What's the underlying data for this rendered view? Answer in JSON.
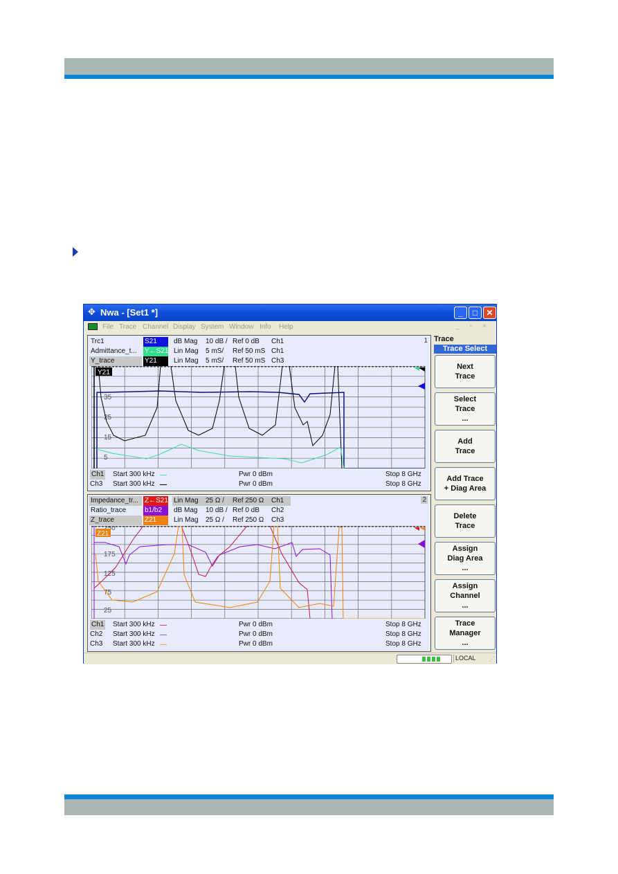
{
  "page": {
    "header_color": "#aab8b5",
    "accent_color": "#0a84d6"
  },
  "window": {
    "title": "Nwa - [Set1 *]",
    "controls": {
      "minimize": "_",
      "maximize": "□",
      "close": "✕"
    },
    "menu": [
      "File",
      "Trace",
      "Channel",
      "Display",
      "System",
      "Window",
      "Info",
      "Help"
    ],
    "mdi_controls": "_ ▫ ×"
  },
  "diagram1": {
    "area_number": "1",
    "traces": [
      {
        "name": "Trc1",
        "tag": "S21",
        "tag_color": "#1010e0",
        "format": "dB Mag",
        "scale": "10 dB /",
        "ref": "Ref 0 dB",
        "channel": "Ch1",
        "selected": false
      },
      {
        "name": "Admittance_t...",
        "tag": "Y←S21",
        "tag_color": "#2ee08a",
        "format": "Lin Mag",
        "scale": "5 mS/",
        "ref": "Ref 50 mS",
        "channel": "Ch1",
        "selected": false
      },
      {
        "name": "Y_trace",
        "tag": "Y21",
        "tag_color": "#000000",
        "format": "Lin Mag",
        "scale": "5 mS/",
        "ref": "Ref 50 mS",
        "channel": "Ch3",
        "selected": true
      }
    ],
    "active_label": "Y21",
    "y_ticks": [
      "35",
      "25",
      "15",
      "5"
    ],
    "channels": [
      {
        "ch": "Ch1",
        "start": "Start  300 kHz",
        "pwr": "Pwr  0 dBm",
        "stop": "Stop  8 GHz",
        "line_color": "#40d8b0"
      },
      {
        "ch": "Ch3",
        "start": "Start  300 kHz",
        "pwr": "Pwr  0 dBm",
        "stop": "Stop  8 GHz",
        "line_color": "#000000"
      }
    ]
  },
  "diagram2": {
    "area_number": "2",
    "traces": [
      {
        "name": "Impedance_tr...",
        "tag": "Z←S21",
        "tag_color": "#e01818",
        "format": "Lin Mag",
        "scale": "25 Ω /",
        "ref": "Ref 250 Ω",
        "channel": "Ch1",
        "selected": true
      },
      {
        "name": "Ratio_trace",
        "tag": "b1/b2",
        "tag_color": "#8a10d8",
        "format": "dB Mag",
        "scale": "10 dB /",
        "ref": "Ref 0 dB",
        "channel": "Ch2",
        "selected": false
      },
      {
        "name": "Z_trace",
        "tag": "Z21",
        "tag_color": "#f08010",
        "format": "Lin Mag",
        "scale": "25 Ω /",
        "ref": "Ref 250 Ω",
        "channel": "Ch3",
        "selected": true
      }
    ],
    "active_label": "Z21",
    "y_ticks": [
      "250",
      "175",
      "125",
      "75",
      "25"
    ],
    "channels": [
      {
        "ch": "Ch1",
        "start": "Start  300 kHz",
        "pwr": "Pwr  0 dBm",
        "stop": "Stop  8 GHz",
        "line_color": "#d04070"
      },
      {
        "ch": "Ch2",
        "start": "Start  300 kHz",
        "pwr": "Pwr  0 dBm",
        "stop": "Stop  8 GHz",
        "line_color": "#8a6ad8"
      },
      {
        "ch": "Ch3",
        "start": "Start  300 kHz",
        "pwr": "Pwr  0 dBm",
        "stop": "Stop  8 GHz",
        "line_color": "#f0a050"
      }
    ]
  },
  "softkeys": {
    "menu_title": "Trace",
    "submenu": "Trace Select",
    "buttons": [
      "Next\nTrace",
      "Select\nTrace\n...",
      "Add\nTrace",
      "Add Trace\n+ Diag Area",
      "Delete\nTrace",
      "Assign\nDiag Area\n...",
      "Assign\nChannel\n...",
      "Trace\nManager\n..."
    ]
  },
  "statusbar": {
    "progress_blocks": 4,
    "mode": "LOCAL"
  }
}
